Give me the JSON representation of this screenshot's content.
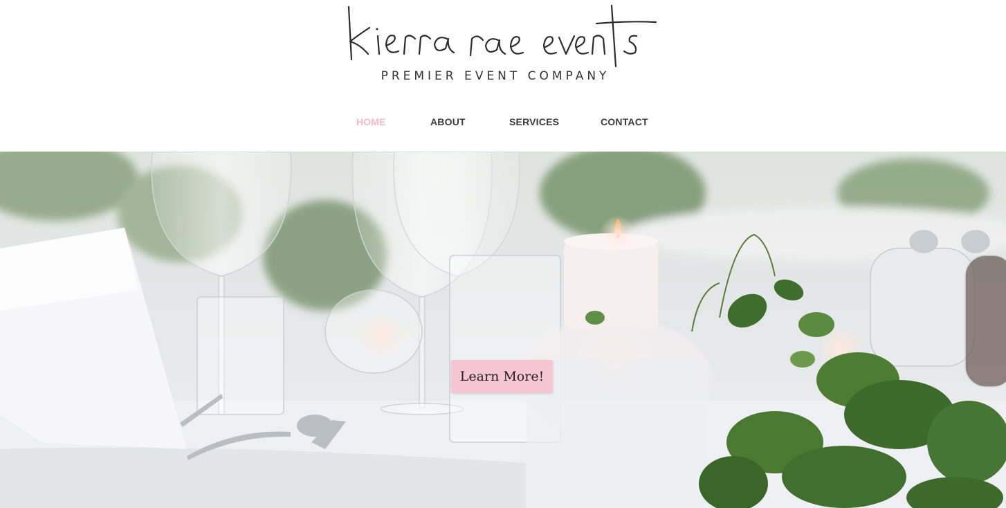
{
  "brand": {
    "logo_text": "kierra rae events",
    "tagline": "PREMIER EVENT COMPANY",
    "accent_color": "#f4b8c8"
  },
  "nav": {
    "items": [
      {
        "label": "HOME",
        "active": true
      },
      {
        "label": "ABOUT",
        "active": false
      },
      {
        "label": "SERVICES",
        "active": false
      },
      {
        "label": "CONTACT",
        "active": false
      }
    ]
  },
  "hero": {
    "image_icon": "table-setting-photo",
    "cta_label": "Learn More!",
    "cta_color": "#f7c6d3"
  }
}
